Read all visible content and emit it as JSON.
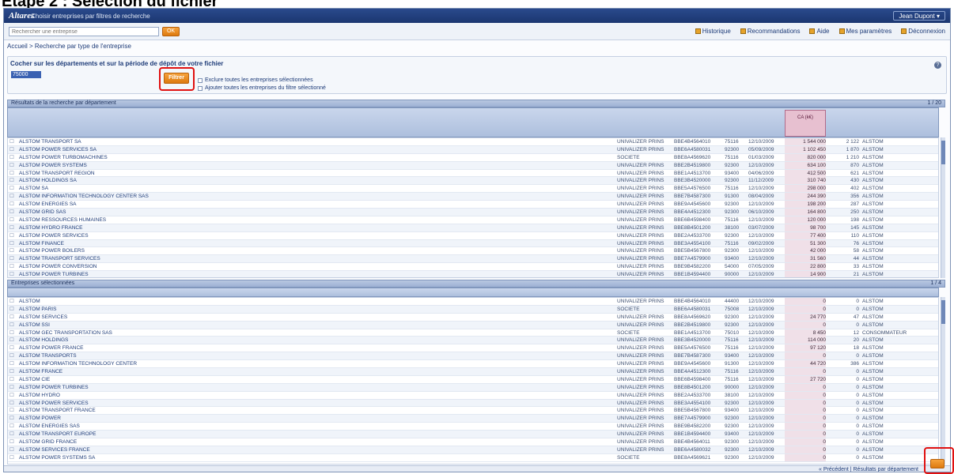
{
  "step_title": "Etape 2 : Sélection du fichier",
  "app": {
    "logo": "Altares",
    "title": "Choisir entreprises par filtres de recherche",
    "user_menu": "Jean Dupont ▾"
  },
  "search": {
    "placeholder": "Rechercher une entreprise",
    "go_label": "OK"
  },
  "top_links": [
    "Historique",
    "Recommandations",
    "Aide",
    "Mes paramètres",
    "Déconnexion"
  ],
  "breadcrumb": "Accueil > Recherche par type de l'entreprise",
  "filter_panel": {
    "label": "Cocher sur les départements et sur la période de dépôt de votre fichier",
    "value": "75000",
    "filter_button": "Filtrer",
    "option1": "Exclure toutes les entreprises sélectionnées",
    "option2": "Ajouter toutes les entreprises du filtre sélectionné",
    "help_icon": "?"
  },
  "section1": {
    "title": "Résultats de la recherche par département",
    "pager": "1 / 20",
    "selected_col": "CA (k€)"
  },
  "section2": {
    "title": "Entreprises sélectionnées",
    "pager": "1 / 4"
  },
  "grid1_rows": [
    {
      "name": "ALSTOM TRANSPORT SA",
      "pr": "UNIVALIZER PRINS",
      "code": "BBE4B4564010",
      "cp": "75116",
      "dt": "12/10/2009",
      "ca": "1 544 000",
      "eff": "2 122",
      "ville": "ALSTOM"
    },
    {
      "name": "ALSTOM POWER SERVICES SA",
      "pr": "UNIVALIZER PRINS",
      "code": "BBE6A4580031",
      "cp": "92300",
      "dt": "05/09/2009",
      "ca": "1 102 450",
      "eff": "1 870",
      "ville": "ALSTOM"
    },
    {
      "name": "ALSTOM POWER TURBOMACHINES",
      "pr": "SOCIETE",
      "code": "BBE8A4569620",
      "cp": "75116",
      "dt": "01/03/2009",
      "ca": "820 000",
      "eff": "1 210",
      "ville": "ALSTOM"
    },
    {
      "name": "ALSTOM POWER SYSTEMS",
      "pr": "UNIVALIZER PRINS",
      "code": "BBE2B4519800",
      "cp": "92300",
      "dt": "12/10/2009",
      "ca": "634 100",
      "eff": "870",
      "ville": "ALSTOM"
    },
    {
      "name": "ALSTOM TRANSPORT REGION",
      "pr": "UNIVALIZER PRINS",
      "code": "BBE1A4513700",
      "cp": "93400",
      "dt": "04/06/2009",
      "ca": "412 500",
      "eff": "621",
      "ville": "ALSTOM"
    },
    {
      "name": "ALSTOM HOLDINGS SA",
      "pr": "UNIVALIZER PRINS",
      "code": "BBE3B4520000",
      "cp": "92300",
      "dt": "11/12/2009",
      "ca": "310 740",
      "eff": "430",
      "ville": "ALSTOM"
    },
    {
      "name": "ALSTOM SA",
      "pr": "UNIVALIZER PRINS",
      "code": "BBE5A4576500",
      "cp": "75116",
      "dt": "12/10/2009",
      "ca": "298 000",
      "eff": "402",
      "ville": "ALSTOM"
    },
    {
      "name": "ALSTOM INFORMATION TECHNOLOGY CENTER SAS",
      "pr": "UNIVALIZER PRINS",
      "code": "BBE7B4587300",
      "cp": "91300",
      "dt": "08/04/2009",
      "ca": "244 390",
      "eff": "356",
      "ville": "ALSTOM"
    },
    {
      "name": "ALSTOM ENERGIES SA",
      "pr": "UNIVALIZER PRINS",
      "code": "BBE9A4545600",
      "cp": "92300",
      "dt": "12/10/2009",
      "ca": "198 200",
      "eff": "287",
      "ville": "ALSTOM"
    },
    {
      "name": "ALSTOM GRID SAS",
      "pr": "UNIVALIZER PRINS",
      "code": "BBE4A4512300",
      "cp": "92300",
      "dt": "06/10/2009",
      "ca": "164 800",
      "eff": "250",
      "ville": "ALSTOM"
    },
    {
      "name": "ALSTOM RESSOURCES HUMAINES",
      "pr": "UNIVALIZER PRINS",
      "code": "BBE6B4598400",
      "cp": "75116",
      "dt": "12/10/2009",
      "ca": "120 000",
      "eff": "198",
      "ville": "ALSTOM"
    },
    {
      "name": "ALSTOM HYDRO FRANCE",
      "pr": "UNIVALIZER PRINS",
      "code": "BBE8B4501200",
      "cp": "38100",
      "dt": "03/07/2009",
      "ca": "98 700",
      "eff": "145",
      "ville": "ALSTOM"
    },
    {
      "name": "ALSTOM POWER SERVICES",
      "pr": "UNIVALIZER PRINS",
      "code": "BBE2A4533700",
      "cp": "92300",
      "dt": "12/10/2009",
      "ca": "77 400",
      "eff": "110",
      "ville": "ALSTOM"
    },
    {
      "name": "ALSTOM FINANCE",
      "pr": "UNIVALIZER PRINS",
      "code": "BBE3A4554100",
      "cp": "75116",
      "dt": "09/02/2009",
      "ca": "51 300",
      "eff": "76",
      "ville": "ALSTOM"
    },
    {
      "name": "ALSTOM POWER BOILERS",
      "pr": "UNIVALIZER PRINS",
      "code": "BBE5B4567800",
      "cp": "92300",
      "dt": "12/10/2009",
      "ca": "42 000",
      "eff": "58",
      "ville": "ALSTOM"
    },
    {
      "name": "ALSTOM TRANSPORT SERVICES",
      "pr": "UNIVALIZER PRINS",
      "code": "BBE7A4579900",
      "cp": "93400",
      "dt": "12/10/2009",
      "ca": "31 560",
      "eff": "44",
      "ville": "ALSTOM"
    },
    {
      "name": "ALSTOM POWER CONVERSION",
      "pr": "UNIVALIZER PRINS",
      "code": "BBE9B4582200",
      "cp": "54000",
      "dt": "07/05/2009",
      "ca": "22 800",
      "eff": "33",
      "ville": "ALSTOM"
    },
    {
      "name": "ALSTOM POWER TURBINES",
      "pr": "UNIVALIZER PRINS",
      "code": "BBE1B4594400",
      "cp": "90000",
      "dt": "12/10/2009",
      "ca": "14 900",
      "eff": "21",
      "ville": "ALSTOM"
    }
  ],
  "grid2_rows": [
    {
      "name": "ALSTOM",
      "pr": "UNIVALIZER PRINS",
      "code": "BBE4B4564010",
      "cp": "44400",
      "dt": "12/10/2009",
      "ca": "0",
      "eff": "0",
      "ville": "ALSTOM"
    },
    {
      "name": "ALSTOM PARIS",
      "pr": "SOCIETE",
      "code": "BBE6A4580031",
      "cp": "75008",
      "dt": "12/10/2009",
      "ca": "0",
      "eff": "0",
      "ville": "ALSTOM"
    },
    {
      "name": "ALSTOM SERVICES",
      "pr": "UNIVALIZER PRINS",
      "code": "BBE8A4569620",
      "cp": "92300",
      "dt": "12/10/2009",
      "ca": "24 770",
      "eff": "47",
      "ville": "ALSTOM"
    },
    {
      "name": "ALSTOM SSI",
      "pr": "UNIVALIZER PRINS",
      "code": "BBE2B4519800",
      "cp": "92300",
      "dt": "12/10/2009",
      "ca": "0",
      "eff": "0",
      "ville": "ALSTOM"
    },
    {
      "name": "ALSTOM GEC TRANSPORTATION SAS",
      "pr": "SOCIETE",
      "code": "BBE1A4513700",
      "cp": "75010",
      "dt": "12/10/2009",
      "ca": "8 450",
      "eff": "12",
      "ville": "CONSOMMATEUR"
    },
    {
      "name": "ALSTOM HOLDINGS",
      "pr": "UNIVALIZER PRINS",
      "code": "BBE3B4520000",
      "cp": "75116",
      "dt": "12/10/2009",
      "ca": "114 000",
      "eff": "20",
      "ville": "ALSTOM"
    },
    {
      "name": "ALSTOM POWER FRANCE",
      "pr": "UNIVALIZER PRINS",
      "code": "BBE5A4576500",
      "cp": "75116",
      "dt": "12/10/2009",
      "ca": "97 120",
      "eff": "18",
      "ville": "ALSTOM"
    },
    {
      "name": "ALSTOM TRANSPORTS",
      "pr": "UNIVALIZER PRINS",
      "code": "BBE7B4587300",
      "cp": "93400",
      "dt": "12/10/2009",
      "ca": "0",
      "eff": "0",
      "ville": "ALSTOM"
    },
    {
      "name": "ALSTOM INFORMATION TECHNOLOGY CENTER",
      "pr": "UNIVALIZER PRINS",
      "code": "BBE9A4545600",
      "cp": "91300",
      "dt": "12/10/2009",
      "ca": "44 720",
      "eff": "386",
      "ville": "ALSTOM"
    },
    {
      "name": "ALSTOM FRANCE",
      "pr": "UNIVALIZER PRINS",
      "code": "BBE4A4512300",
      "cp": "75116",
      "dt": "12/10/2009",
      "ca": "0",
      "eff": "0",
      "ville": "ALSTOM"
    },
    {
      "name": "ALSTOM CIE",
      "pr": "UNIVALIZER PRINS",
      "code": "BBE6B4598400",
      "cp": "75116",
      "dt": "12/10/2009",
      "ca": "27 720",
      "eff": "0",
      "ville": "ALSTOM"
    },
    {
      "name": "ALSTOM POWER TURBINES",
      "pr": "UNIVALIZER PRINS",
      "code": "BBE8B4501200",
      "cp": "90000",
      "dt": "12/10/2009",
      "ca": "0",
      "eff": "0",
      "ville": "ALSTOM"
    },
    {
      "name": "ALSTOM HYDRO",
      "pr": "UNIVALIZER PRINS",
      "code": "BBE2A4533700",
      "cp": "38100",
      "dt": "12/10/2009",
      "ca": "0",
      "eff": "0",
      "ville": "ALSTOM"
    },
    {
      "name": "ALSTOM POWER SERVICES",
      "pr": "UNIVALIZER PRINS",
      "code": "BBE3A4554100",
      "cp": "92300",
      "dt": "12/10/2009",
      "ca": "0",
      "eff": "0",
      "ville": "ALSTOM"
    },
    {
      "name": "ALSTOM TRANSPORT FRANCE",
      "pr": "UNIVALIZER PRINS",
      "code": "BBE5B4567800",
      "cp": "93400",
      "dt": "12/10/2009",
      "ca": "0",
      "eff": "0",
      "ville": "ALSTOM"
    },
    {
      "name": "ALSTOM POWER",
      "pr": "UNIVALIZER PRINS",
      "code": "BBE7A4579900",
      "cp": "92300",
      "dt": "12/10/2009",
      "ca": "0",
      "eff": "0",
      "ville": "ALSTOM"
    },
    {
      "name": "ALSTOM ENERGIES SAS",
      "pr": "UNIVALIZER PRINS",
      "code": "BBE9B4582200",
      "cp": "92300",
      "dt": "12/10/2009",
      "ca": "0",
      "eff": "0",
      "ville": "ALSTOM"
    },
    {
      "name": "ALSTOM TRANSPORT EUROPE",
      "pr": "UNIVALIZER PRINS",
      "code": "BBE1B4594400",
      "cp": "93400",
      "dt": "12/10/2009",
      "ca": "0",
      "eff": "0",
      "ville": "ALSTOM"
    },
    {
      "name": "ALSTOM GRID FRANCE",
      "pr": "UNIVALIZER PRINS",
      "code": "BBE4B4564011",
      "cp": "92300",
      "dt": "12/10/2009",
      "ca": "0",
      "eff": "0",
      "ville": "ALSTOM"
    },
    {
      "name": "ALSTOM SERVICES FRANCE",
      "pr": "UNIVALIZER PRINS",
      "code": "BBE6A4580032",
      "cp": "92300",
      "dt": "12/10/2009",
      "ca": "0",
      "eff": "0",
      "ville": "ALSTOM"
    },
    {
      "name": "ALSTOM POWER SYSTEMS SA",
      "pr": "SOCIETE",
      "code": "BBE8A4569621",
      "cp": "92300",
      "dt": "12/10/2009",
      "ca": "0",
      "eff": "0",
      "ville": "ALSTOM"
    }
  ],
  "footer": {
    "links": "« Précédent | Résultats par département",
    "export_label": "Exporter"
  },
  "colors": {
    "topbar": "#1b3670",
    "accent": "#dd7a10",
    "highlight": "#e01010"
  }
}
